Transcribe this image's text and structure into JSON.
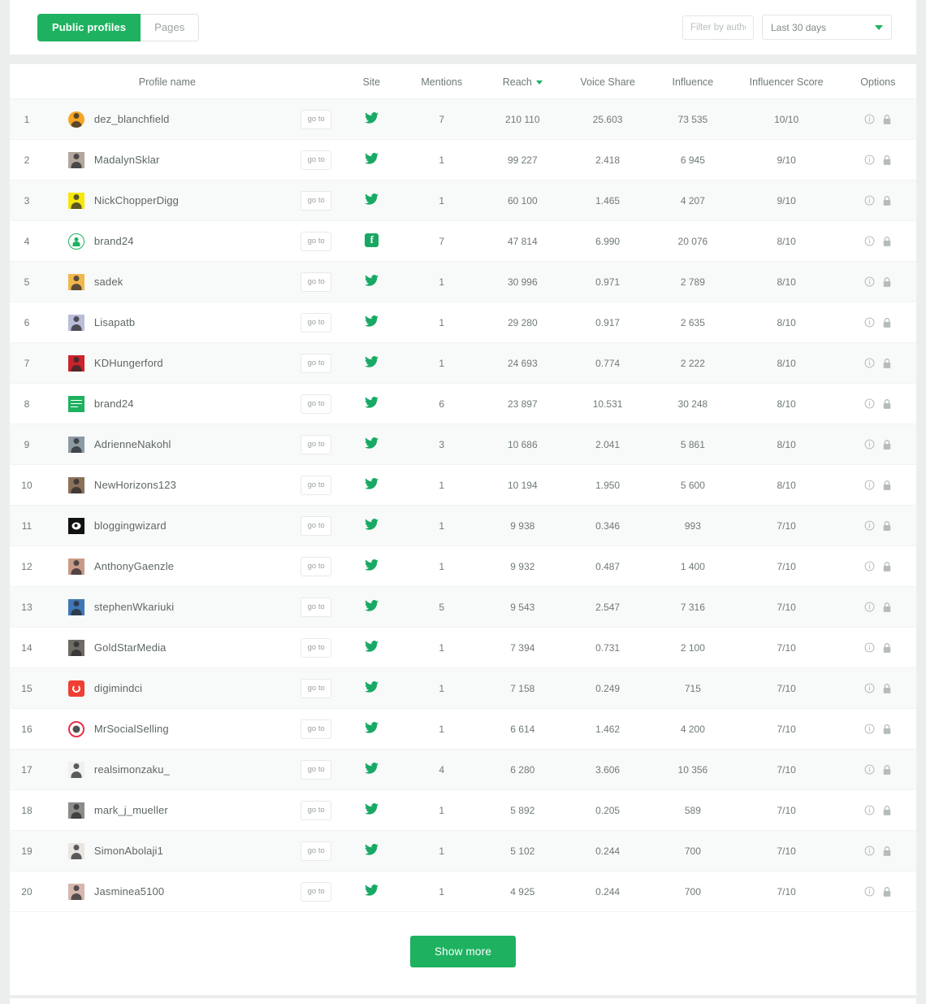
{
  "toolbar": {
    "tabs": [
      {
        "label": "Public profiles",
        "active": true
      },
      {
        "label": "Pages",
        "active": false
      }
    ],
    "author_filter": {
      "value": "",
      "placeholder": "Filter by author"
    },
    "date_range": {
      "value": "Last 30 days",
      "caret_icon": "chevron-down-icon"
    }
  },
  "table": {
    "columns": {
      "profile_name": "Profile name",
      "site": "Site",
      "mentions": "Mentions",
      "reach": "Reach",
      "voice_share": "Voice Share",
      "influence": "Influence",
      "influencer_score": "Influencer Score",
      "options": "Options"
    },
    "sorted_by": "Reach",
    "sort_caret_icon": "caret-down-icon",
    "goto_label": "go to",
    "row_icons": {
      "info": "info-circle-icon",
      "lock": "lock-icon"
    },
    "rows": [
      {
        "rank": "1",
        "name": "dez_blanchfield",
        "avatar": "photo-orange-circle",
        "site": "twitter",
        "mentions": "7",
        "reach": "210 110",
        "voice_share": "25.603",
        "influence": "73 535",
        "score": "10/10"
      },
      {
        "rank": "2",
        "name": "MadalynSklar",
        "avatar": "photo-tan",
        "site": "twitter",
        "mentions": "1",
        "reach": "99 227",
        "voice_share": "2.418",
        "influence": "6 945",
        "score": "9/10"
      },
      {
        "rank": "3",
        "name": "NickChopperDigg",
        "avatar": "photo-yellow",
        "site": "twitter",
        "mentions": "1",
        "reach": "60 100",
        "voice_share": "1.465",
        "influence": "4 207",
        "score": "9/10"
      },
      {
        "rank": "4",
        "name": "brand24",
        "avatar": "green-ring-person",
        "site": "facebook",
        "mentions": "7",
        "reach": "47 814",
        "voice_share": "6.990",
        "influence": "20 076",
        "score": "8/10"
      },
      {
        "rank": "5",
        "name": "sadek",
        "avatar": "photo-amber",
        "site": "twitter",
        "mentions": "1",
        "reach": "30 996",
        "voice_share": "0.971",
        "influence": "2 789",
        "score": "8/10"
      },
      {
        "rank": "6",
        "name": "Lisapatb",
        "avatar": "photo-lavender",
        "site": "twitter",
        "mentions": "1",
        "reach": "29 280",
        "voice_share": "0.917",
        "influence": "2 635",
        "score": "8/10"
      },
      {
        "rank": "7",
        "name": "KDHungerford",
        "avatar": "photo-red",
        "site": "twitter",
        "mentions": "1",
        "reach": "24 693",
        "voice_share": "0.774",
        "influence": "2 222",
        "score": "8/10"
      },
      {
        "rank": "8",
        "name": "brand24",
        "avatar": "brand24-green-logo",
        "site": "twitter",
        "mentions": "6",
        "reach": "23 897",
        "voice_share": "10.531",
        "influence": "30 248",
        "score": "8/10"
      },
      {
        "rank": "9",
        "name": "AdrienneNakohl",
        "avatar": "photo-slate",
        "site": "twitter",
        "mentions": "3",
        "reach": "10 686",
        "voice_share": "2.041",
        "influence": "5 861",
        "score": "8/10"
      },
      {
        "rank": "10",
        "name": "NewHorizons123",
        "avatar": "photo-brown",
        "site": "twitter",
        "mentions": "1",
        "reach": "10 194",
        "voice_share": "1.950",
        "influence": "5 600",
        "score": "8/10"
      },
      {
        "rank": "11",
        "name": "bloggingwizard",
        "avatar": "eye-black-logo",
        "site": "twitter",
        "mentions": "1",
        "reach": "9 938",
        "voice_share": "0.346",
        "influence": "993",
        "score": "7/10"
      },
      {
        "rank": "12",
        "name": "AnthonyGaenzle",
        "avatar": "photo-warm",
        "site": "twitter",
        "mentions": "1",
        "reach": "9 932",
        "voice_share": "0.487",
        "influence": "1 400",
        "score": "7/10"
      },
      {
        "rank": "13",
        "name": "stephenWkariuki",
        "avatar": "photo-blue",
        "site": "twitter",
        "mentions": "5",
        "reach": "9 543",
        "voice_share": "2.547",
        "influence": "7 316",
        "score": "7/10"
      },
      {
        "rank": "14",
        "name": "GoldStarMedia",
        "avatar": "photo-dark",
        "site": "twitter",
        "mentions": "1",
        "reach": "7 394",
        "voice_share": "0.731",
        "influence": "2 100",
        "score": "7/10"
      },
      {
        "rank": "15",
        "name": "digimindci",
        "avatar": "digimind-red-logo",
        "site": "twitter",
        "mentions": "1",
        "reach": "7 158",
        "voice_share": "0.249",
        "influence": "715",
        "score": "7/10"
      },
      {
        "rank": "16",
        "name": "MrSocialSelling",
        "avatar": "target-red-logo",
        "site": "twitter",
        "mentions": "1",
        "reach": "6 614",
        "voice_share": "1.462",
        "influence": "4 200",
        "score": "7/10"
      },
      {
        "rank": "17",
        "name": "realsimonzaku_",
        "avatar": "photo-white",
        "site": "twitter",
        "mentions": "4",
        "reach": "6 280",
        "voice_share": "3.606",
        "influence": "10 356",
        "score": "7/10"
      },
      {
        "rank": "18",
        "name": "mark_j_mueller",
        "avatar": "photo-grey",
        "site": "twitter",
        "mentions": "1",
        "reach": "5 892",
        "voice_share": "0.205",
        "influence": "589",
        "score": "7/10"
      },
      {
        "rank": "19",
        "name": "SimonAbolaji1",
        "avatar": "photo-pale",
        "site": "twitter",
        "mentions": "1",
        "reach": "5 102",
        "voice_share": "0.244",
        "influence": "700",
        "score": "7/10"
      },
      {
        "rank": "20",
        "name": "Jasminea5100",
        "avatar": "photo-rose",
        "site": "twitter",
        "mentions": "1",
        "reach": "4 925",
        "voice_share": "0.244",
        "influence": "700",
        "score": "7/10"
      }
    ]
  },
  "footer": {
    "show_more_label": "Show more"
  },
  "colors": {
    "brand_green": "#1eb260",
    "twitter_icon": "#18a964",
    "facebook_icon": "#19a863",
    "row_alt": "#f8f9f9",
    "page_bg": "#eceeed",
    "text": "#6f7a78"
  }
}
